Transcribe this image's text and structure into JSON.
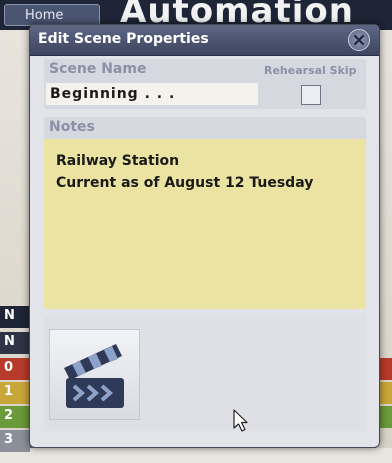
{
  "background": {
    "home_tab": "Home",
    "app_title": "Automation",
    "left_rows": [
      "N",
      "N",
      "0",
      "1",
      "2",
      "3"
    ],
    "row_colors": [
      "#1e2536",
      "#2e3446",
      "#b83a2a",
      "#c9a63a",
      "#6a9a3a",
      "#8a8f9a"
    ]
  },
  "dialog": {
    "title": "Edit Scene Properties",
    "close_icon": "close-circle-icon",
    "scene_name_label": "Scene Name",
    "scene_name_value": "Beginning . . .",
    "rehearsal_skip_label": "Rehearsal Skip",
    "rehearsal_skip_checked": false,
    "notes_label": "Notes",
    "notes_lines": [
      "Railway Station",
      "Current as of  August 12 Tuesday"
    ],
    "media_icon": "clapperboard-icon"
  },
  "colors": {
    "titlebar": "#4a5370",
    "notes_background": "#ebe3a2",
    "label_text": "#8b90a6",
    "dialog_background": "#e3e4ea"
  }
}
